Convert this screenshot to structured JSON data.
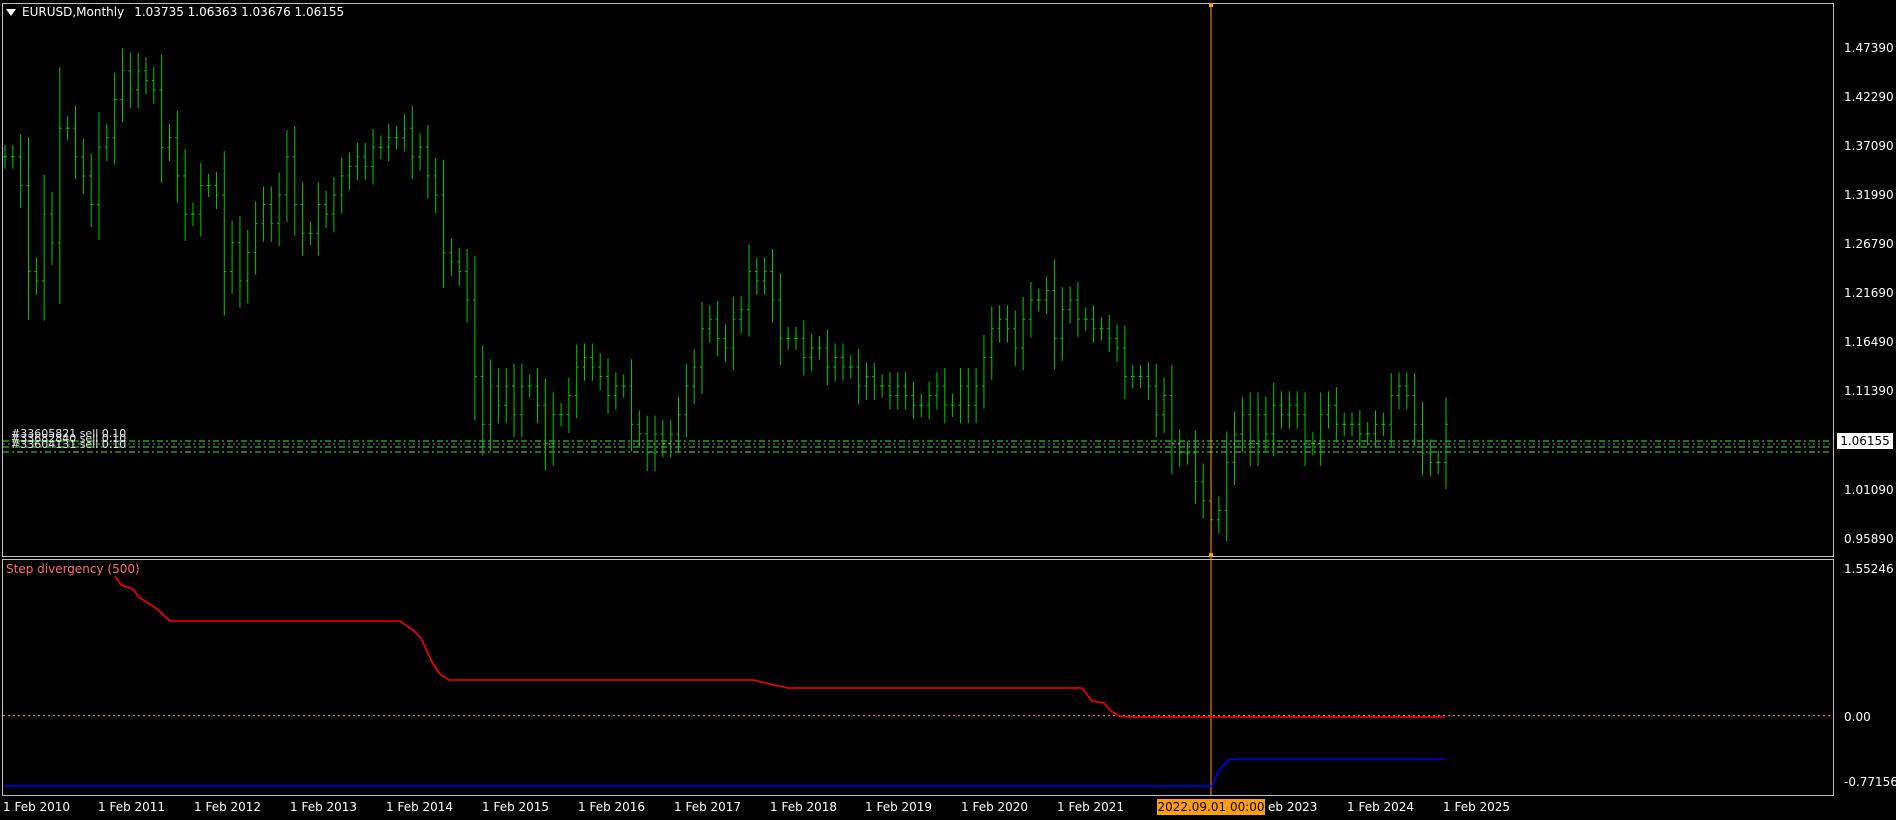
{
  "header": {
    "symbol_timeframe": "EURUSD,Monthly",
    "ohlc": "1.03735 1.06363 1.03676 1.06155"
  },
  "current_price": "1.06155",
  "price_axis": [
    "1.47390",
    "1.42290",
    "1.37090",
    "1.31990",
    "1.26790",
    "1.21690",
    "1.16490",
    "1.11390",
    "1.01090",
    "0.95890"
  ],
  "indicator": {
    "title": "Step divergency (500)",
    "axis": [
      "1.55246",
      "0.00",
      "-0.77156"
    ]
  },
  "time_axis": [
    "1 Feb 2010",
    "1 Feb 2011",
    "1 Feb 2012",
    "1 Feb 2013",
    "1 Feb 2014",
    "1 Feb 2015",
    "1 Feb 2016",
    "1 Feb 2017",
    "1 Feb 2018",
    "1 Feb 2019",
    "1 Feb 2020",
    "1 Feb 2021",
    "eb 2023",
    "1 Feb 2024",
    "1 Feb 2025"
  ],
  "crosshair_time": "2022.09.01 00:00",
  "orders": [
    "#33605821 sell 0.10",
    "#33682840 sell 0.10",
    "#33604131 sell 0.10"
  ],
  "colors": {
    "background": "#000000",
    "bars": "#00c800",
    "grid": "#c0c0c0",
    "order_lines": "#22a022",
    "crosshair": "#ff9d0a",
    "indicator_red": "#ff0000",
    "indicator_blue": "#0000ff",
    "zero_line": "#ff9d0a"
  },
  "chart_data": {
    "type": "ohlc",
    "timeframe": "Monthly",
    "x": "months Feb 2010 – Apr 2025",
    "close": [
      1.36,
      1.36,
      1.33,
      1.24,
      1.23,
      1.3,
      1.27,
      1.39,
      1.39,
      1.36,
      1.34,
      1.31,
      1.37,
      1.38,
      1.42,
      1.45,
      1.43,
      1.45,
      1.44,
      1.43,
      1.37,
      1.38,
      1.34,
      1.3,
      1.3,
      1.33,
      1.33,
      1.32,
      1.24,
      1.27,
      1.23,
      1.26,
      1.29,
      1.31,
      1.29,
      1.32,
      1.36,
      1.31,
      1.28,
      1.28,
      1.31,
      1.3,
      1.32,
      1.34,
      1.35,
      1.36,
      1.35,
      1.37,
      1.37,
      1.38,
      1.38,
      1.39,
      1.36,
      1.37,
      1.34,
      1.32,
      1.26,
      1.25,
      1.24,
      1.21,
      1.13,
      1.08,
      1.12,
      1.1,
      1.12,
      1.09,
      1.12,
      1.12,
      1.1,
      1.06,
      1.09,
      1.09,
      1.11,
      1.14,
      1.15,
      1.14,
      1.13,
      1.11,
      1.12,
      1.12,
      1.08,
      1.07,
      1.05,
      1.07,
      1.06,
      1.07,
      1.09,
      1.12,
      1.14,
      1.18,
      1.19,
      1.17,
      1.16,
      1.19,
      1.2,
      1.24,
      1.23,
      1.24,
      1.21,
      1.17,
      1.17,
      1.17,
      1.15,
      1.16,
      1.16,
      1.14,
      1.15,
      1.14,
      1.14,
      1.12,
      1.13,
      1.12,
      1.12,
      1.11,
      1.12,
      1.11,
      1.1,
      1.1,
      1.11,
      1.12,
      1.1,
      1.1,
      1.12,
      1.1,
      1.12,
      1.15,
      1.18,
      1.19,
      1.18,
      1.16,
      1.19,
      1.21,
      1.21,
      1.22,
      1.17,
      1.2,
      1.21,
      1.19,
      1.19,
      1.18,
      1.18,
      1.17,
      1.16,
      1.13,
      1.13,
      1.13,
      1.12,
      1.09,
      1.11,
      1.06,
      1.05,
      1.05,
      1.02,
      1.0,
      0.98,
      0.99,
      1.04,
      1.07,
      1.09,
      1.06,
      1.09,
      1.07,
      1.1,
      1.09,
      1.1,
      1.09,
      1.06,
      1.06,
      1.09,
      1.1,
      1.08,
      1.08,
      1.08,
      1.07,
      1.07,
      1.08,
      1.08,
      1.11,
      1.12,
      1.11,
      1.08,
      1.05,
      1.04,
      1.04,
      1.08
    ],
    "high_max": 1.4939,
    "low_min": 0.9536,
    "order_levels": [
      1.062,
      1.056,
      1.054
    ],
    "indicator_series": [
      {
        "name": "red step",
        "color": "#ff0000"
      },
      {
        "name": "blue step",
        "color": "#0000ff"
      }
    ],
    "indicator_range": [
      -0.77156,
      1.55246
    ]
  }
}
